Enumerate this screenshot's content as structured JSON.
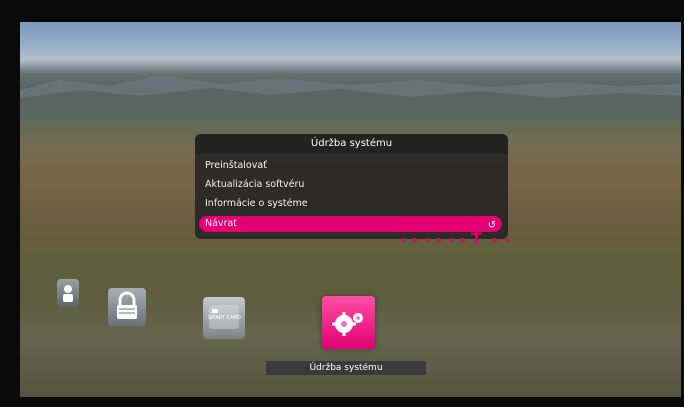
{
  "dialog": {
    "title": "Údržba systému",
    "items": [
      {
        "label": "Preinštalovať"
      },
      {
        "label": "Aktualizácia softvéru"
      },
      {
        "label": "Informácie o systéme"
      },
      {
        "label": "Návrat",
        "selected": true
      }
    ]
  },
  "icons": [
    {
      "name": "user-icon",
      "label": ""
    },
    {
      "name": "lock-icon",
      "label": ""
    },
    {
      "name": "smart-card-icon",
      "label": "SMART CARD"
    },
    {
      "name": "settings-icon",
      "label": ""
    }
  ],
  "status": {
    "label": "Údržba systému"
  },
  "colors": {
    "accent": "#e20074"
  }
}
